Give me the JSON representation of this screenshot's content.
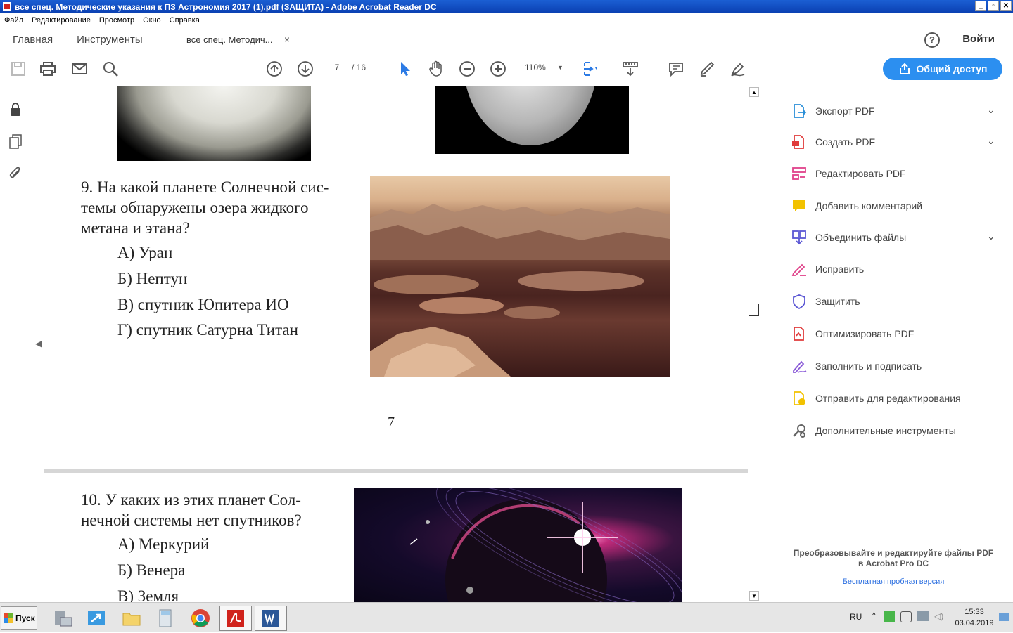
{
  "window": {
    "title": "все спец. Методические указания к ПЗ Астрономия 2017 (1).pdf (ЗАЩИТА) - Adobe Acrobat Reader DC",
    "controls": [
      "_",
      "▫",
      "✕"
    ]
  },
  "menu": [
    "Файл",
    "Редактирование",
    "Просмотр",
    "Окно",
    "Справка"
  ],
  "nav": {
    "home": "Главная",
    "tools": "Инструменты",
    "doc_tab": "все спец. Методич...",
    "close": "×",
    "help": "?",
    "login": "Войти"
  },
  "toolbar": {
    "page_current": "7",
    "page_total": "/ 16",
    "zoom": "110%",
    "zoom_arrow": "▼",
    "share": "Общий доступ"
  },
  "document": {
    "q9": {
      "text": "9. На какой планете Солнечной системы обнаружены озера жидкого метана и этана?",
      "line1": "9. На какой планете Солнечной сис-",
      "line2": "темы обнаружены озера жидкого",
      "line3": "метана и этана?",
      "answers": [
        "А) Уран",
        "Б) Нептун",
        "В) спутник Юпитера  ИО",
        "Г) спутник Сатурна Титан"
      ]
    },
    "page_number": "7",
    "q10": {
      "line1": "10. У каких из этих планет Сол-",
      "line2": "нечной системы нет спутников?",
      "answers": [
        "А) Меркурий",
        "Б) Венера",
        "В) Земля"
      ]
    }
  },
  "tools_panel": {
    "items": [
      {
        "label": "Экспорт PDF",
        "icon": "export-pdf-icon",
        "chevron": true,
        "color": "#2a8fd8"
      },
      {
        "label": "Создать PDF",
        "icon": "create-pdf-icon",
        "chevron": true,
        "color": "#e03a3a"
      },
      {
        "label": "Редактировать PDF",
        "icon": "edit-pdf-icon",
        "chevron": false,
        "color": "#e0428a"
      },
      {
        "label": "Добавить комментарий",
        "icon": "comment-icon",
        "chevron": false,
        "color": "#f2c200"
      },
      {
        "label": "Объединить файлы",
        "icon": "combine-files-icon",
        "chevron": true,
        "color": "#5b57d4"
      },
      {
        "label": "Исправить",
        "icon": "fix-pen-icon",
        "chevron": false,
        "color": "#e0428a"
      },
      {
        "label": "Защитить",
        "icon": "shield-icon",
        "chevron": false,
        "color": "#5b57d4"
      },
      {
        "label": "Оптимизировать PDF",
        "icon": "optimize-pdf-icon",
        "chevron": false,
        "color": "#e03a3a"
      },
      {
        "label": "Заполнить и подписать",
        "icon": "fill-sign-icon",
        "chevron": false,
        "color": "#8b5cd8"
      },
      {
        "label": "Отправить для редактирования",
        "icon": "send-review-icon",
        "chevron": false,
        "color": "#f2c200"
      },
      {
        "label": "Дополнительные инструменты",
        "icon": "more-tools-icon",
        "chevron": false,
        "color": "#666666"
      }
    ],
    "promo_line1": "Преобразовывайте и редактируйте файлы PDF",
    "promo_line2": "в Acrobat Pro DC",
    "trial": "Бесплатная пробная версия"
  },
  "taskbar": {
    "start": "Пуск",
    "lang": "RU",
    "time": "15:33",
    "date": "03.04.2019"
  },
  "colors": {
    "accent": "#2c8ff0",
    "titlebar": "#0a3fb1"
  }
}
